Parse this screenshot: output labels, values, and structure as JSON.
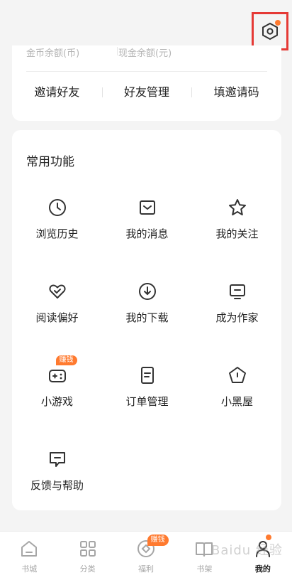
{
  "wallet": {
    "gold_label": "金币余额(币)",
    "cash_label": "现金余额(元)",
    "invite_items": [
      "邀请好友",
      "好友管理",
      "填邀请码"
    ]
  },
  "functions": {
    "title": "常用功能",
    "items": [
      {
        "label": "浏览历史",
        "icon": "clock-icon"
      },
      {
        "label": "我的消息",
        "icon": "message-icon"
      },
      {
        "label": "我的关注",
        "icon": "star-icon"
      },
      {
        "label": "阅读偏好",
        "icon": "heart-check-icon"
      },
      {
        "label": "我的下载",
        "icon": "download-icon"
      },
      {
        "label": "成为作家",
        "icon": "monitor-icon"
      },
      {
        "label": "小游戏",
        "icon": "gamepad-icon",
        "badge": "赚钱"
      },
      {
        "label": "订单管理",
        "icon": "document-icon"
      },
      {
        "label": "小黑屋",
        "icon": "pentagon-icon"
      },
      {
        "label": "反馈与帮助",
        "icon": "feedback-icon"
      }
    ]
  },
  "nav": {
    "items": [
      {
        "label": "书城",
        "icon": "home-icon"
      },
      {
        "label": "分类",
        "icon": "grid-icon"
      },
      {
        "label": "福利",
        "icon": "coin-icon",
        "badge": "赚钱"
      },
      {
        "label": "书架",
        "icon": "book-icon"
      },
      {
        "label": "我的",
        "icon": "person-icon",
        "active": true
      }
    ]
  },
  "watermark": "Baidu 经验",
  "colors": {
    "accent": "#ff7a2f",
    "highlight": "#e53935",
    "text": "#222222"
  }
}
